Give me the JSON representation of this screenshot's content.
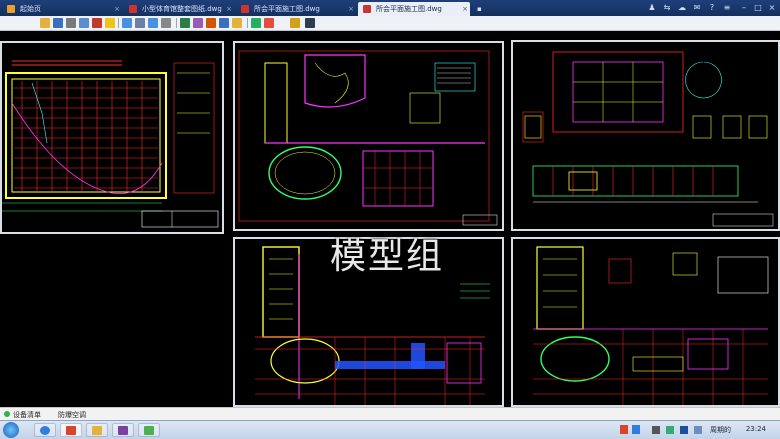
{
  "tabs": [
    {
      "label": "起始页",
      "active": false
    },
    {
      "label": "小型体育馆整套图纸.dwg",
      "active": false
    },
    {
      "label": "所会平面施工图.dwg",
      "active": false
    },
    {
      "label": "所会平面施工图.dwg",
      "active": true
    }
  ],
  "watermark": "模型组",
  "status": {
    "left_label": "设备清单",
    "right_label": "防爆空调"
  },
  "taskbar": {
    "tray_text": "周期的",
    "clock": "23:24"
  },
  "colors": {
    "tab_bar": "#1e3f7a",
    "canvas": "#000000",
    "cad_red": "#ff2a2a",
    "cad_yellow": "#ffff33",
    "cad_green": "#33ff66",
    "cad_magenta": "#ff33ff",
    "cad_cyan": "#33ffff"
  },
  "icons": [
    "open-icon",
    "save-icon",
    "print-icon",
    "zoom-icon",
    "pan-icon",
    "layer-icon",
    "text-icon",
    "measure-icon"
  ]
}
